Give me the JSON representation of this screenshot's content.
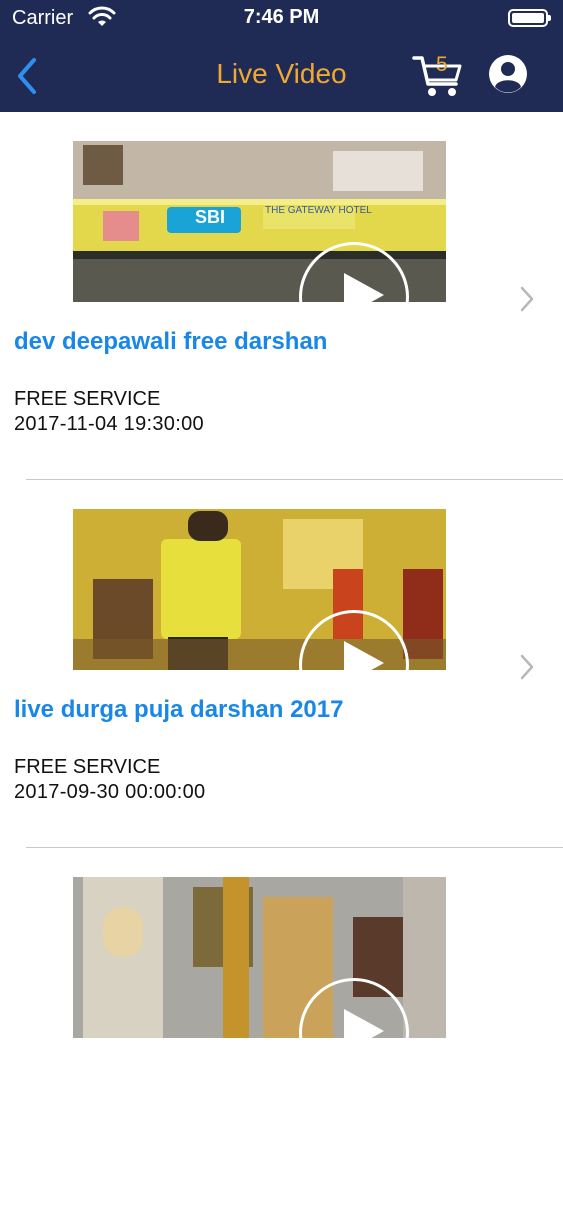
{
  "status_bar": {
    "carrier": "Carrier",
    "time": "7:46 PM"
  },
  "nav": {
    "title": "Live Video",
    "cart_count": "5",
    "back_icon": "chevron-left-icon",
    "cart_icon": "cart-icon",
    "profile_icon": "user-icon"
  },
  "colors": {
    "header_bg": "#1f2b55",
    "title_accent": "#f0a830",
    "link_blue": "#1987e8",
    "back_blue": "#2f8ff0"
  },
  "videos": [
    {
      "title": "dev deepawali free darshan",
      "service": "FREE SERVICE",
      "date": "2017-11-04 19:30:00",
      "thumb_banner_left": "SBI",
      "thumb_banner_right": "THE GATEWAY HOTEL"
    },
    {
      "title": "live durga puja darshan 2017",
      "service": "FREE SERVICE",
      "date": "2017-09-30 00:00:00"
    },
    {
      "title": "",
      "service": "",
      "date": ""
    }
  ]
}
